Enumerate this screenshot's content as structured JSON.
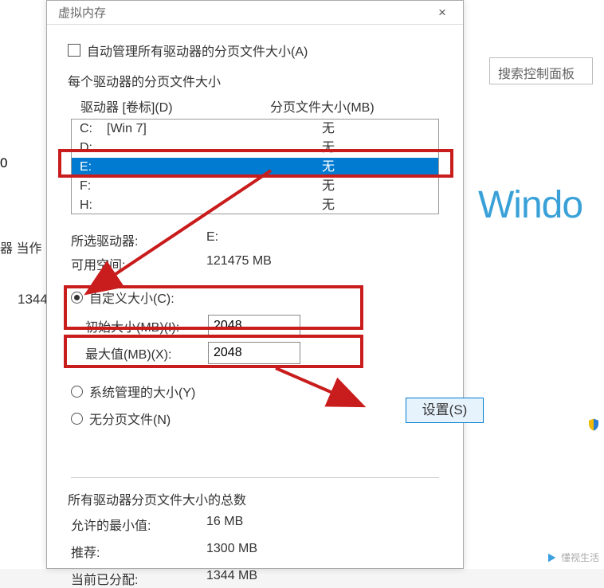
{
  "dialog": {
    "title": "虚拟内存",
    "auto_manage_label": "自动管理所有驱动器的分页文件大小(A)",
    "per_drive_label": "每个驱动器的分页文件大小",
    "col_drive": "驱动器 [卷标](D)",
    "col_size": "分页文件大小(MB)",
    "drives": [
      {
        "letter": "C:",
        "label": "[Win 7]",
        "value": "无",
        "selected": false
      },
      {
        "letter": "D:",
        "label": "",
        "value": "无",
        "selected": false
      },
      {
        "letter": "E:",
        "label": "",
        "value": "无",
        "selected": true
      },
      {
        "letter": "F:",
        "label": "",
        "value": "无",
        "selected": false
      },
      {
        "letter": "H:",
        "label": "",
        "value": "无",
        "selected": false
      }
    ],
    "selected_drive_label": "所选驱动器:",
    "selected_drive_value": "E:",
    "avail_label": "可用空间:",
    "avail_value": "121475 MB",
    "radio_custom": "自定义大小(C):",
    "initial_label": "初始大小(MB)(I):",
    "initial_value": "2048",
    "max_label": "最大值(MB)(X):",
    "max_value": "2048",
    "radio_system": "系统管理的大小(Y)",
    "radio_none": "无分页文件(N)",
    "btn_set": "设置(S)",
    "totals_header": "所有驱动器分页文件大小的总数",
    "min_label": "允许的最小值:",
    "min_value": "16 MB",
    "rec_label": "推荐:",
    "rec_value": "1300 MB",
    "cur_label": "当前已分配:",
    "cur_value": "1344 MB"
  },
  "bg": {
    "search_placeholder": "搜索控制面板",
    "operate": "器 当作 R…",
    "num": "1344",
    "windo": "Windo",
    "zero": "0",
    "logo_text": "懂视生活"
  }
}
